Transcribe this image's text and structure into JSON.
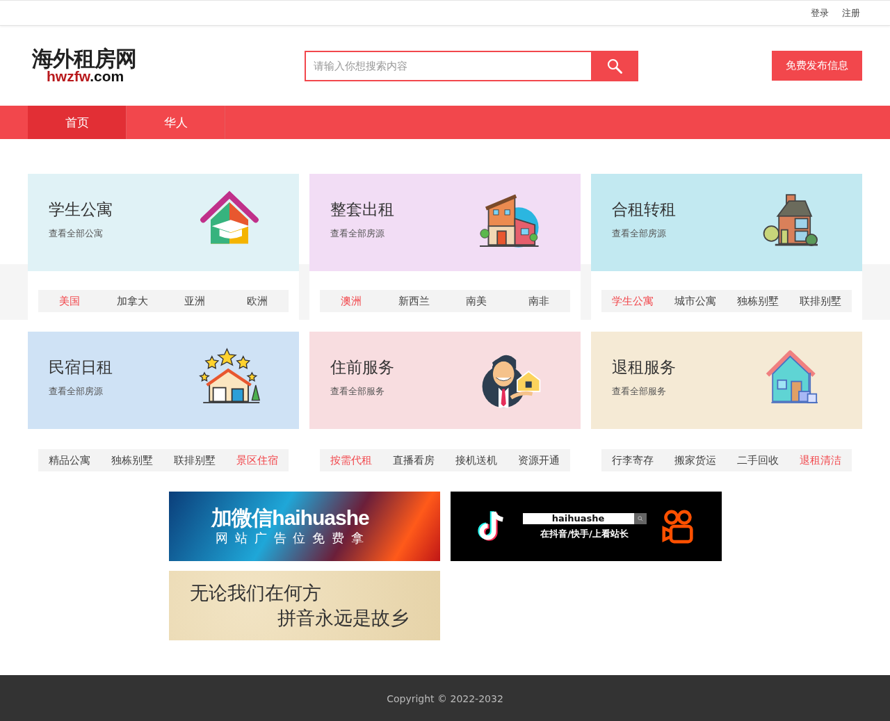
{
  "top_links": [
    "登录",
    "注册"
  ],
  "logo": {
    "name": "海外租房网",
    "domain_parts": [
      {
        "text": "hwzfw",
        "accent": true
      },
      {
        "text": ".com",
        "accent": false
      }
    ]
  },
  "search": {
    "placeholder": "请输入你想搜索内容"
  },
  "publish_button": "免费发布信息",
  "nav": [
    {
      "label": "首页",
      "selected": true
    },
    {
      "label": "华人",
      "selected": false
    }
  ],
  "category_rows": [
    {
      "band": true,
      "cards": [
        {
          "title": "学生公寓",
          "subtitle": "查看全部公寓",
          "color": "#e0f2f6",
          "kind": "grad",
          "links": [
            {
              "label": "美国",
              "selected": true
            },
            {
              "label": "加拿大",
              "selected": false
            },
            {
              "label": "亚洲",
              "selected": false
            },
            {
              "label": "欧洲",
              "selected": false
            }
          ]
        },
        {
          "title": "整套出租",
          "subtitle": "查看全部房源",
          "color": "#f2ddf5",
          "kind": "house",
          "links": [
            {
              "label": "澳洲",
              "selected": true
            },
            {
              "label": "新西兰",
              "selected": false
            },
            {
              "label": "南美",
              "selected": false
            },
            {
              "label": "南非",
              "selected": false
            }
          ]
        },
        {
          "title": "合租转租",
          "subtitle": "查看全部房源",
          "color": "#c2e9f1",
          "kind": "cottage",
          "links": [
            {
              "label": "学生公寓",
              "selected": true
            },
            {
              "label": "城市公寓",
              "selected": false
            },
            {
              "label": "独栋别墅",
              "selected": false
            },
            {
              "label": "联排别墅",
              "selected": false
            }
          ]
        }
      ]
    },
    {
      "band": false,
      "cards": [
        {
          "title": "民宿日租",
          "subtitle": "查看全部房源",
          "color": "#cfe2f5",
          "kind": "stars",
          "links": [
            {
              "label": "精品公寓",
              "selected": false
            },
            {
              "label": "独栋别墅",
              "selected": false
            },
            {
              "label": "联排别墅",
              "selected": false
            },
            {
              "label": "景区住宿",
              "selected": true
            }
          ]
        },
        {
          "title": "住前服务",
          "subtitle": "查看全部服务",
          "color": "#f8dde0",
          "kind": "agent",
          "links": [
            {
              "label": "按需代租",
              "selected": true
            },
            {
              "label": "直播看房",
              "selected": false
            },
            {
              "label": "接机送机",
              "selected": false
            },
            {
              "label": "资源开通",
              "selected": false
            }
          ]
        },
        {
          "title": "退租服务",
          "subtitle": "查看全部服务",
          "color": "#f5ead5",
          "kind": "clean",
          "links": [
            {
              "label": "行李寄存",
              "selected": false
            },
            {
              "label": "搬家货运",
              "selected": false
            },
            {
              "label": "二手回收",
              "selected": false
            },
            {
              "label": "退租清洁",
              "selected": true
            }
          ]
        }
      ]
    }
  ],
  "banners": [
    {
      "kind": "wechat",
      "headline": "加微信haihuashe",
      "subline": "网 站 广 告 位 免 费 拿"
    },
    {
      "kind": "video",
      "handle": "haihuashe",
      "subline": "在抖音/快手/上看站长"
    },
    {
      "kind": "slogan",
      "line_1": "无论我们在何方",
      "line_2": "拼音永远是故乡"
    }
  ],
  "footer": "Copyright © 2022-2032"
}
